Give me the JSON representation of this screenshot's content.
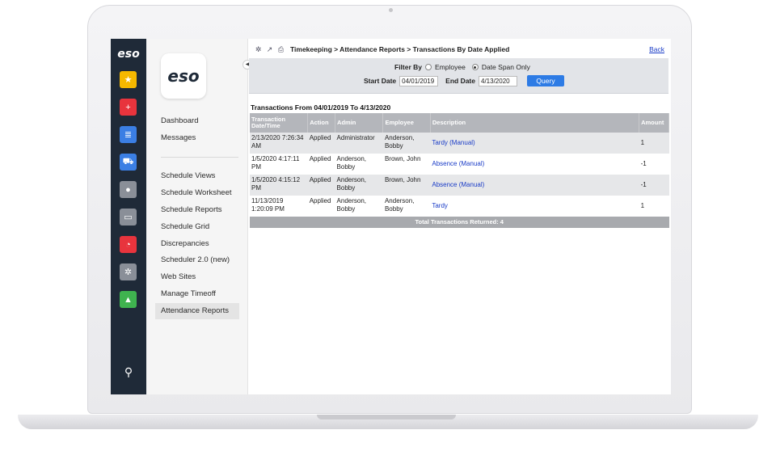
{
  "rail": {
    "logo": "eso",
    "buttons": [
      {
        "name": "star-icon",
        "color": "#f5b800",
        "glyph": "★"
      },
      {
        "name": "medical-icon",
        "color": "#e8343d",
        "glyph": "+"
      },
      {
        "name": "document-icon",
        "color": "#3b7fe4",
        "glyph": "≣"
      },
      {
        "name": "ambulance-icon",
        "color": "#3b7fe4",
        "glyph": "⛟"
      },
      {
        "name": "people-icon",
        "color": "#8a8f98",
        "glyph": "●"
      },
      {
        "name": "briefcase-icon",
        "color": "#8a8f98",
        "glyph": "▭"
      },
      {
        "name": "pie-chart-icon",
        "color": "#e8343d",
        "glyph": "◔"
      },
      {
        "name": "settings-icon",
        "color": "#8a8f98",
        "glyph": "✲"
      },
      {
        "name": "user-icon",
        "color": "#3fb34f",
        "glyph": "▲"
      }
    ],
    "search_glyph": "⚲"
  },
  "sidebar": {
    "logo": "eso",
    "items": [
      {
        "label": "Dashboard",
        "active": false
      },
      {
        "label": "Messages",
        "active": false
      },
      {
        "label": "Schedule Views",
        "active": false
      },
      {
        "label": "Schedule Worksheet",
        "active": false
      },
      {
        "label": "Schedule Reports",
        "active": false
      },
      {
        "label": "Schedule Grid",
        "active": false
      },
      {
        "label": "Discrepancies",
        "active": false
      },
      {
        "label": "Scheduler 2.0 (new)",
        "active": false
      },
      {
        "label": "Web Sites",
        "active": false
      },
      {
        "label": "Manage Timeoff",
        "active": false
      },
      {
        "label": "Attendance Reports",
        "active": true
      }
    ]
  },
  "header": {
    "breadcrumb": "Timekeeping > Attendance Reports > Transactions By Date Applied",
    "back_label": "Back"
  },
  "filter": {
    "filter_by_label": "Filter By",
    "option_employee": "Employee",
    "option_date_span": "Date Span Only",
    "selected": "Date Span Only",
    "start_date_label": "Start Date",
    "start_date": "04/01/2019",
    "end_date_label": "End Date",
    "end_date": "4/13/2020",
    "query_label": "Query"
  },
  "report": {
    "title": "Transactions From 04/01/2019 To 4/13/2020",
    "columns": [
      "Transaction Date/Time",
      "Action",
      "Admin",
      "Employee",
      "Description",
      "Amount"
    ],
    "rows": [
      {
        "datetime": "2/13/2020 7:26:34 AM",
        "action": "Applied",
        "admin": "Administrator",
        "employee": "Anderson, Bobby",
        "description": "Tardy (Manual)",
        "amount": "1"
      },
      {
        "datetime": "1/5/2020 4:17:11 PM",
        "action": "Applied",
        "admin": "Anderson, Bobby",
        "employee": "Brown, John",
        "description": "Absence (Manual)",
        "amount": "-1"
      },
      {
        "datetime": "1/5/2020 4:15:12 PM",
        "action": "Applied",
        "admin": "Anderson, Bobby",
        "employee": "Brown, John",
        "description": "Absence (Manual)",
        "amount": "-1"
      },
      {
        "datetime": "11/13/2019 1:20:09 PM",
        "action": "Applied",
        "admin": "Anderson, Bobby",
        "employee": "Anderson, Bobby",
        "description": "Tardy",
        "amount": "1"
      }
    ],
    "total_label": "Total Transactions Returned:  4"
  }
}
